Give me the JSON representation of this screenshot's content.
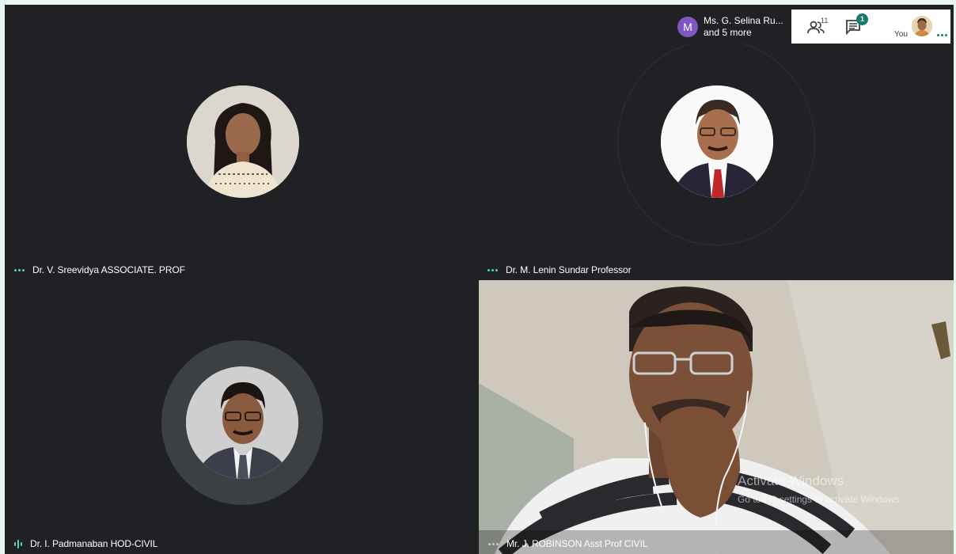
{
  "topbar": {
    "presenter_initial": "M",
    "presenter_name": "Ms. G. Selina Ru...",
    "presenter_more": "and 5 more",
    "participant_count": "11",
    "chat_badge": "1",
    "self_label": "You"
  },
  "tiles": [
    {
      "name": "Dr. V. Sreevidya ASSOCIATE. PROF"
    },
    {
      "name": "Dr. M. Lenin Sundar Professor"
    },
    {
      "name": "Dr. I. Padmanaban HOD-CIVIL"
    },
    {
      "name": "Mr. J. ROBINSON Asst Prof CIVIL"
    }
  ],
  "watermark": {
    "line1": "Activate Windows",
    "line2": "Go to PC settings to activate Windows."
  },
  "colors": {
    "background": "#202124",
    "accent": "#5ad1c1",
    "presenter_avatar": "#7e57c2",
    "chat_badge": "#137c6e"
  }
}
